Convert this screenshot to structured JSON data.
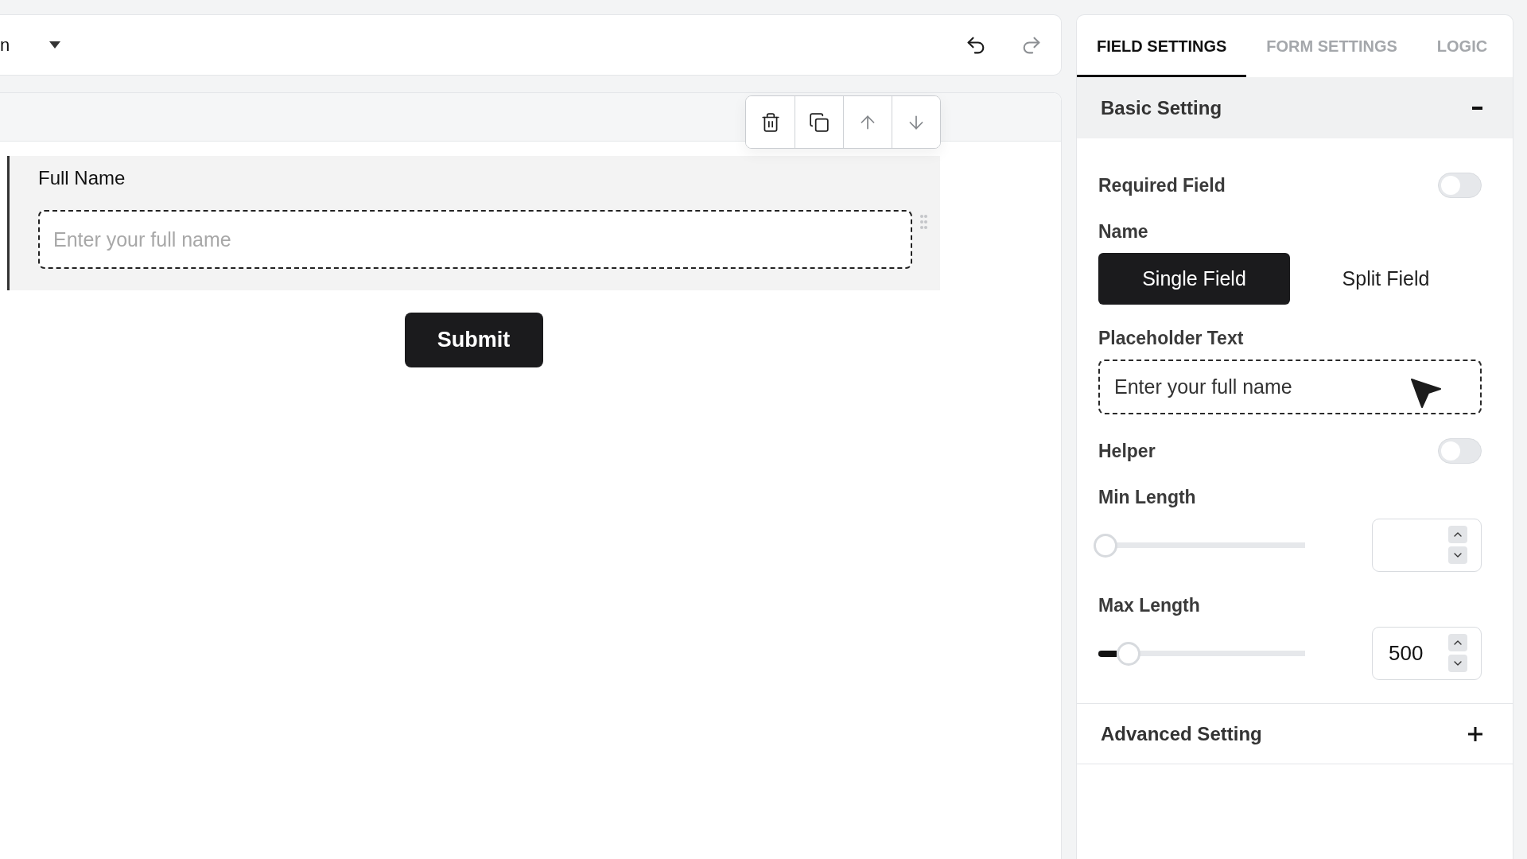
{
  "toolbar": {
    "dropdown_value": "n",
    "history": [
      {
        "kind": "undo",
        "disabled": false
      },
      {
        "kind": "redo",
        "disabled": true
      }
    ]
  },
  "canvas": {
    "field_actions": [
      {
        "kind": "delete",
        "disabled": false
      },
      {
        "kind": "duplicate",
        "disabled": false
      },
      {
        "kind": "move_up",
        "disabled": true
      },
      {
        "kind": "move_down",
        "disabled": true
      }
    ],
    "fields": [
      {
        "label": "Full Name",
        "placeholder": "Enter your full name",
        "selected": true
      }
    ],
    "submit_label": "Submit"
  },
  "settings_panel": {
    "tabs": [
      {
        "label": "FIELD SETTINGS",
        "selected": true
      },
      {
        "label": "FORM SETTINGS",
        "selected": false
      },
      {
        "label": "LOGIC",
        "selected": false
      }
    ],
    "sections": [
      {
        "title": "Basic Setting",
        "expanded": true,
        "settings": [
          {
            "kind": "toggle",
            "label": "Required Field",
            "on": false
          },
          {
            "kind": "segmented",
            "label": "Name",
            "options": [
              {
                "label": "Single Field",
                "selected": true
              },
              {
                "label": "Split Field",
                "selected": false
              }
            ]
          },
          {
            "kind": "text",
            "label": "Placeholder Text",
            "value": "Enter your full name"
          },
          {
            "kind": "toggle",
            "label": "Helper",
            "on": false
          },
          {
            "kind": "range",
            "label": "Min Length",
            "level": 0
          },
          {
            "kind": "range",
            "label": "Max Length",
            "level": 0.12,
            "value": "500"
          }
        ]
      },
      {
        "title": "Advanced Setting",
        "expanded": false
      }
    ]
  }
}
